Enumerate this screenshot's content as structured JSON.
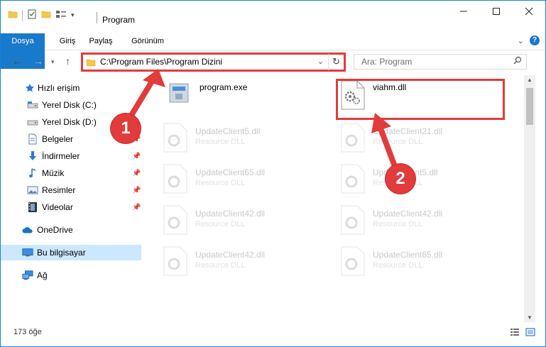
{
  "window": {
    "title": "Program"
  },
  "ribbon": {
    "tabs": [
      "Dosya",
      "Giriş",
      "Paylaş",
      "Görünüm"
    ]
  },
  "navbar": {
    "address": "C:\\Program Files\\Program Dizini",
    "search_placeholder": "Ara: Program"
  },
  "sidebar": {
    "items": [
      {
        "label": "Hızlı erişim",
        "icon": "star-icon"
      },
      {
        "label": "Yerel Disk (C:)",
        "icon": "drive-icon"
      },
      {
        "label": "Yerel Disk (D:)",
        "icon": "drive-icon"
      },
      {
        "label": "Belgeler",
        "icon": "document-icon"
      },
      {
        "label": "İndirmeler",
        "icon": "download-icon"
      },
      {
        "label": "Müzik",
        "icon": "music-icon"
      },
      {
        "label": "Resimler",
        "icon": "pictures-icon"
      },
      {
        "label": "Videolar",
        "icon": "video-icon"
      },
      {
        "label": "OneDrive",
        "icon": "cloud-icon"
      },
      {
        "label": "Bu bilgisayar",
        "icon": "computer-icon"
      },
      {
        "label": "Ağ",
        "icon": "network-icon"
      }
    ]
  },
  "files": [
    {
      "name": "program.exe",
      "type": ""
    },
    {
      "name": "viahm.dll",
      "type": ""
    },
    {
      "name": "UpdateClient5.dll",
      "type": "Resource DLL"
    },
    {
      "name": "UpdateClient21.dll",
      "type": "Resource DLL"
    },
    {
      "name": "UpdateClient65.dll",
      "type": "Resource DLL"
    },
    {
      "name": "UpdateClient5.dll",
      "type": "Resource DLL"
    },
    {
      "name": "UpdateClient42.dll",
      "type": "Resource DLL"
    },
    {
      "name": "UpdateClient42.dll",
      "type": "Resource DLL"
    },
    {
      "name": "UpdateClient42.dll",
      "type": "Resource DLL"
    },
    {
      "name": "UpdateClient65.dll",
      "type": "Resource DLL"
    }
  ],
  "status": {
    "item_count": "173 öğe"
  },
  "callouts": {
    "one": "1",
    "two": "2"
  },
  "colors": {
    "accent": "#1979ca",
    "highlight": "#e23b3b",
    "selected": "#cce8ff"
  }
}
